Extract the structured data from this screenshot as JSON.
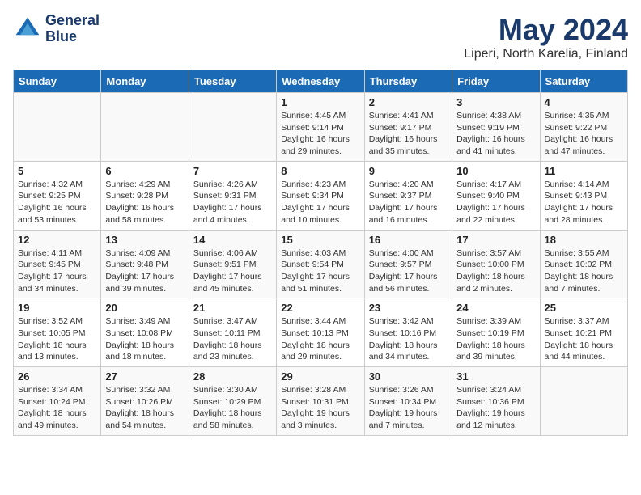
{
  "header": {
    "logo_line1": "General",
    "logo_line2": "Blue",
    "month": "May 2024",
    "location": "Liperi, North Karelia, Finland"
  },
  "weekdays": [
    "Sunday",
    "Monday",
    "Tuesday",
    "Wednesday",
    "Thursday",
    "Friday",
    "Saturday"
  ],
  "weeks": [
    [
      {
        "day": "",
        "info": ""
      },
      {
        "day": "",
        "info": ""
      },
      {
        "day": "",
        "info": ""
      },
      {
        "day": "1",
        "info": "Sunrise: 4:45 AM\nSunset: 9:14 PM\nDaylight: 16 hours\nand 29 minutes."
      },
      {
        "day": "2",
        "info": "Sunrise: 4:41 AM\nSunset: 9:17 PM\nDaylight: 16 hours\nand 35 minutes."
      },
      {
        "day": "3",
        "info": "Sunrise: 4:38 AM\nSunset: 9:19 PM\nDaylight: 16 hours\nand 41 minutes."
      },
      {
        "day": "4",
        "info": "Sunrise: 4:35 AM\nSunset: 9:22 PM\nDaylight: 16 hours\nand 47 minutes."
      }
    ],
    [
      {
        "day": "5",
        "info": "Sunrise: 4:32 AM\nSunset: 9:25 PM\nDaylight: 16 hours\nand 53 minutes."
      },
      {
        "day": "6",
        "info": "Sunrise: 4:29 AM\nSunset: 9:28 PM\nDaylight: 16 hours\nand 58 minutes."
      },
      {
        "day": "7",
        "info": "Sunrise: 4:26 AM\nSunset: 9:31 PM\nDaylight: 17 hours\nand 4 minutes."
      },
      {
        "day": "8",
        "info": "Sunrise: 4:23 AM\nSunset: 9:34 PM\nDaylight: 17 hours\nand 10 minutes."
      },
      {
        "day": "9",
        "info": "Sunrise: 4:20 AM\nSunset: 9:37 PM\nDaylight: 17 hours\nand 16 minutes."
      },
      {
        "day": "10",
        "info": "Sunrise: 4:17 AM\nSunset: 9:40 PM\nDaylight: 17 hours\nand 22 minutes."
      },
      {
        "day": "11",
        "info": "Sunrise: 4:14 AM\nSunset: 9:43 PM\nDaylight: 17 hours\nand 28 minutes."
      }
    ],
    [
      {
        "day": "12",
        "info": "Sunrise: 4:11 AM\nSunset: 9:45 PM\nDaylight: 17 hours\nand 34 minutes."
      },
      {
        "day": "13",
        "info": "Sunrise: 4:09 AM\nSunset: 9:48 PM\nDaylight: 17 hours\nand 39 minutes."
      },
      {
        "day": "14",
        "info": "Sunrise: 4:06 AM\nSunset: 9:51 PM\nDaylight: 17 hours\nand 45 minutes."
      },
      {
        "day": "15",
        "info": "Sunrise: 4:03 AM\nSunset: 9:54 PM\nDaylight: 17 hours\nand 51 minutes."
      },
      {
        "day": "16",
        "info": "Sunrise: 4:00 AM\nSunset: 9:57 PM\nDaylight: 17 hours\nand 56 minutes."
      },
      {
        "day": "17",
        "info": "Sunrise: 3:57 AM\nSunset: 10:00 PM\nDaylight: 18 hours\nand 2 minutes."
      },
      {
        "day": "18",
        "info": "Sunrise: 3:55 AM\nSunset: 10:02 PM\nDaylight: 18 hours\nand 7 minutes."
      }
    ],
    [
      {
        "day": "19",
        "info": "Sunrise: 3:52 AM\nSunset: 10:05 PM\nDaylight: 18 hours\nand 13 minutes."
      },
      {
        "day": "20",
        "info": "Sunrise: 3:49 AM\nSunset: 10:08 PM\nDaylight: 18 hours\nand 18 minutes."
      },
      {
        "day": "21",
        "info": "Sunrise: 3:47 AM\nSunset: 10:11 PM\nDaylight: 18 hours\nand 23 minutes."
      },
      {
        "day": "22",
        "info": "Sunrise: 3:44 AM\nSunset: 10:13 PM\nDaylight: 18 hours\nand 29 minutes."
      },
      {
        "day": "23",
        "info": "Sunrise: 3:42 AM\nSunset: 10:16 PM\nDaylight: 18 hours\nand 34 minutes."
      },
      {
        "day": "24",
        "info": "Sunrise: 3:39 AM\nSunset: 10:19 PM\nDaylight: 18 hours\nand 39 minutes."
      },
      {
        "day": "25",
        "info": "Sunrise: 3:37 AM\nSunset: 10:21 PM\nDaylight: 18 hours\nand 44 minutes."
      }
    ],
    [
      {
        "day": "26",
        "info": "Sunrise: 3:34 AM\nSunset: 10:24 PM\nDaylight: 18 hours\nand 49 minutes."
      },
      {
        "day": "27",
        "info": "Sunrise: 3:32 AM\nSunset: 10:26 PM\nDaylight: 18 hours\nand 54 minutes."
      },
      {
        "day": "28",
        "info": "Sunrise: 3:30 AM\nSunset: 10:29 PM\nDaylight: 18 hours\nand 58 minutes."
      },
      {
        "day": "29",
        "info": "Sunrise: 3:28 AM\nSunset: 10:31 PM\nDaylight: 19 hours\nand 3 minutes."
      },
      {
        "day": "30",
        "info": "Sunrise: 3:26 AM\nSunset: 10:34 PM\nDaylight: 19 hours\nand 7 minutes."
      },
      {
        "day": "31",
        "info": "Sunrise: 3:24 AM\nSunset: 10:36 PM\nDaylight: 19 hours\nand 12 minutes."
      },
      {
        "day": "",
        "info": ""
      }
    ]
  ]
}
